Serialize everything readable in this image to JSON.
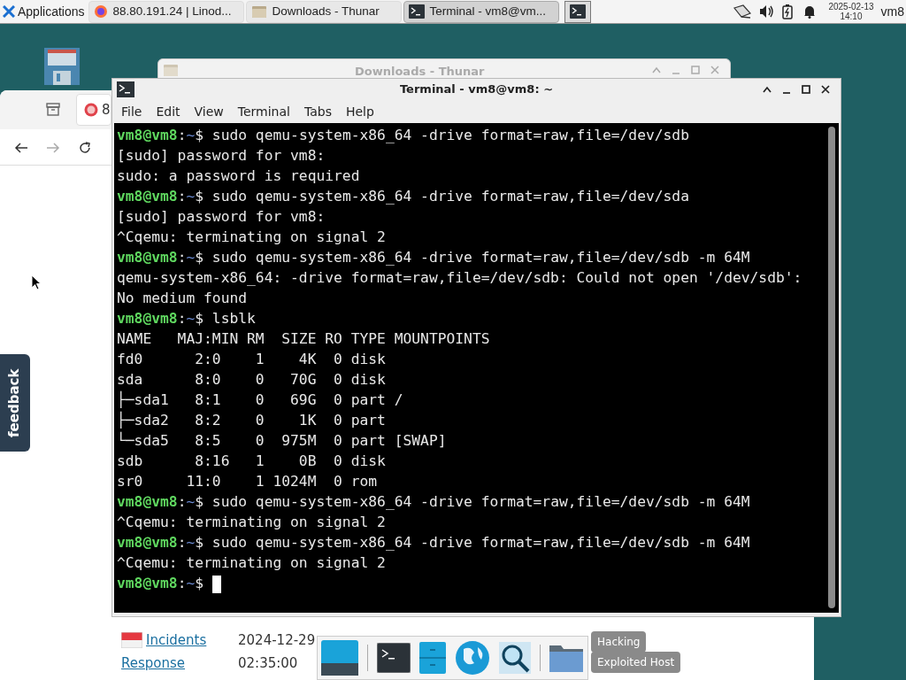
{
  "taskbar": {
    "apps_menu": "Applications",
    "tasks": [
      {
        "kind": "browser",
        "title": "88.80.191.24 | Linod...",
        "selected": false
      },
      {
        "kind": "files",
        "title": "Downloads - Thunar",
        "selected": false
      },
      {
        "kind": "terminal",
        "title": "Terminal - vm8@vm...",
        "selected": true
      }
    ],
    "clock": {
      "date": "2025-02-13",
      "time": "14:10"
    },
    "user": "vm8"
  },
  "browser_window": {
    "tab_label": "8",
    "feedback": "feedback",
    "page": {
      "links": [
        "Incidents",
        "Response"
      ],
      "date": "2024-12-29",
      "time": "02:35:00",
      "tags": [
        "Hacking",
        "Exploited Host"
      ]
    }
  },
  "thunar_window": {
    "title": "Downloads - Thunar"
  },
  "terminal_window": {
    "title": "Terminal - vm8@vm8: ~",
    "menu": [
      "File",
      "Edit",
      "View",
      "Terminal",
      "Tabs",
      "Help"
    ],
    "lines": [
      {
        "kind": "prompt",
        "host": "vm8@vm8",
        "sep": ":",
        "path": "~",
        "symbol": "$",
        "command": "sudo qemu-system-x86_64 -drive format=raw,file=/dev/sdb"
      },
      {
        "kind": "output",
        "text": "[sudo] password for vm8:"
      },
      {
        "kind": "output",
        "text": "sudo: a password is required"
      },
      {
        "kind": "prompt",
        "host": "vm8@vm8",
        "sep": ":",
        "path": "~",
        "symbol": "$",
        "command": "sudo qemu-system-x86_64 -drive format=raw,file=/dev/sda"
      },
      {
        "kind": "output",
        "text": "[sudo] password for vm8:"
      },
      {
        "kind": "output",
        "text": "^Cqemu: terminating on signal 2"
      },
      {
        "kind": "prompt",
        "host": "vm8@vm8",
        "sep": ":",
        "path": "~",
        "symbol": "$",
        "command": "sudo qemu-system-x86_64 -drive format=raw,file=/dev/sdb -m 64M"
      },
      {
        "kind": "output",
        "text": "qemu-system-x86_64: -drive format=raw,file=/dev/sdb: Could not open '/dev/sdb':"
      },
      {
        "kind": "output",
        "text": "No medium found"
      },
      {
        "kind": "prompt",
        "host": "vm8@vm8",
        "sep": ":",
        "path": "~",
        "symbol": "$",
        "command": "lsblk"
      },
      {
        "kind": "output",
        "text": "NAME   MAJ:MIN RM  SIZE RO TYPE MOUNTPOINTS"
      },
      {
        "kind": "output",
        "text": "fd0      2:0    1    4K  0 disk"
      },
      {
        "kind": "output",
        "text": "sda      8:0    0   70G  0 disk"
      },
      {
        "kind": "output",
        "text": "├─sda1   8:1    0   69G  0 part /"
      },
      {
        "kind": "output",
        "text": "├─sda2   8:2    0    1K  0 part"
      },
      {
        "kind": "output",
        "text": "└─sda5   8:5    0  975M  0 part [SWAP]"
      },
      {
        "kind": "output",
        "text": "sdb      8:16   1    0B  0 disk"
      },
      {
        "kind": "output",
        "text": "sr0     11:0    1 1024M  0 rom"
      },
      {
        "kind": "prompt",
        "host": "vm8@vm8",
        "sep": ":",
        "path": "~",
        "symbol": "$",
        "command": "sudo qemu-system-x86_64 -drive format=raw,file=/dev/sdb -m 64M"
      },
      {
        "kind": "output",
        "text": "^Cqemu: terminating on signal 2"
      },
      {
        "kind": "prompt",
        "host": "vm8@vm8",
        "sep": ":",
        "path": "~",
        "symbol": "$",
        "command": "sudo qemu-system-x86_64 -drive format=raw,file=/dev/sdb -m 64M"
      },
      {
        "kind": "output",
        "text": "^Cqemu: terminating on signal 2"
      },
      {
        "kind": "prompt",
        "host": "vm8@vm8",
        "sep": ":",
        "path": "~",
        "symbol": "$"
      }
    ]
  }
}
